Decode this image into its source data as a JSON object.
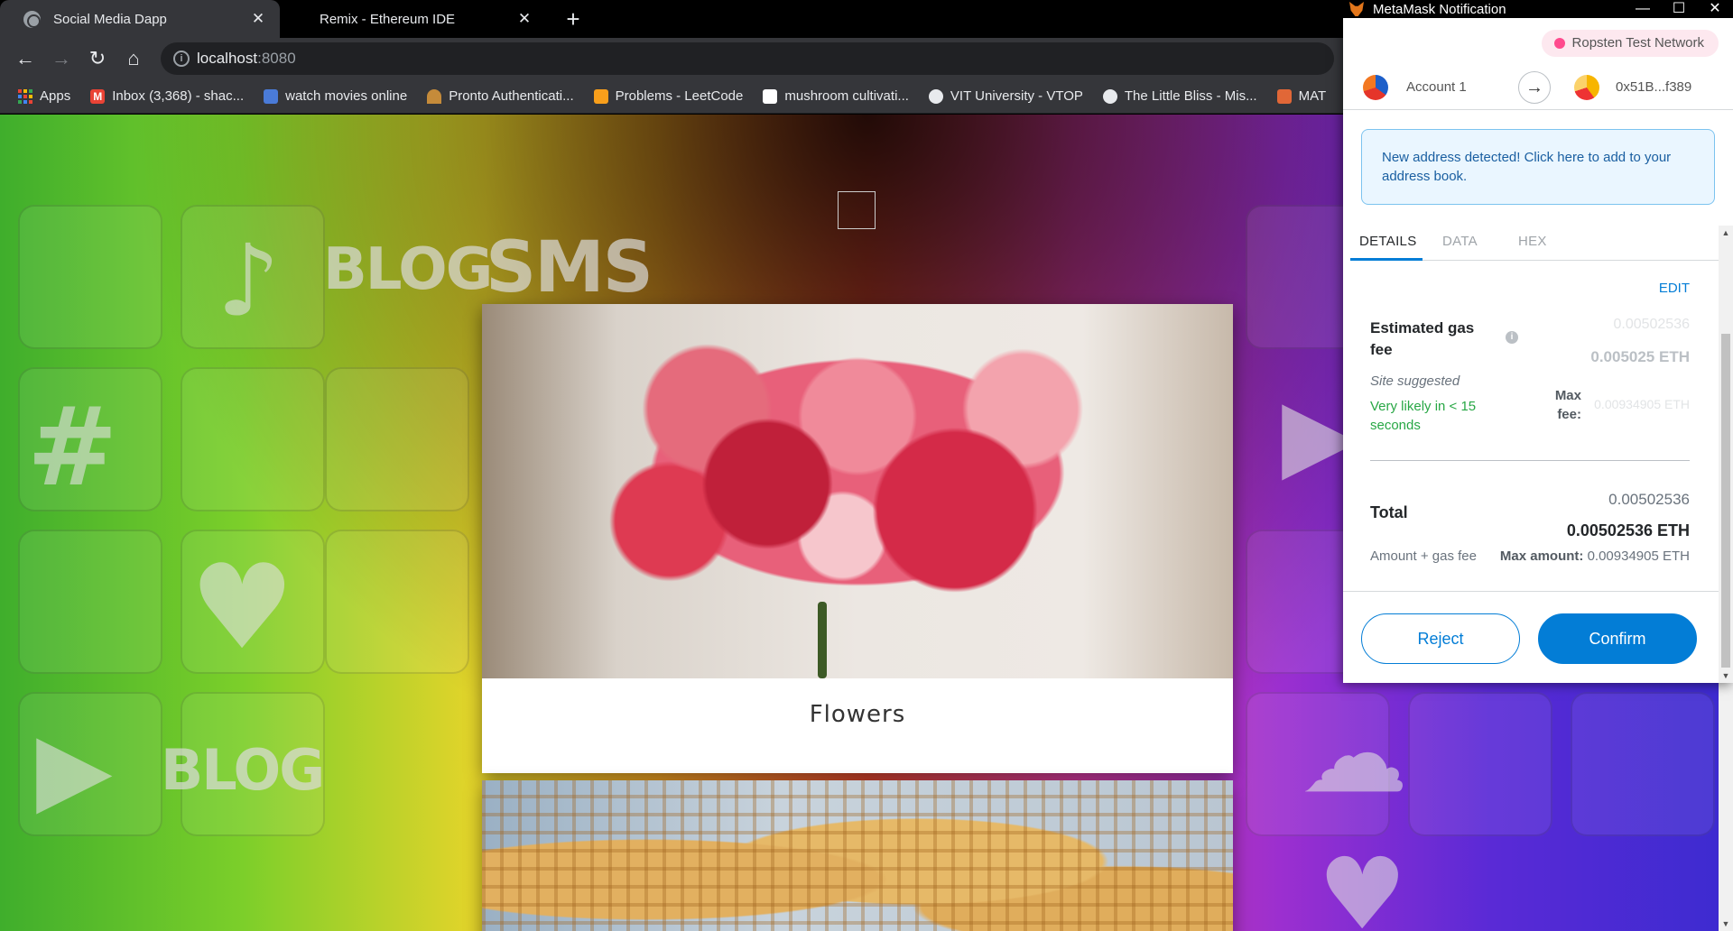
{
  "browser": {
    "tabs": [
      {
        "title": "Social Media Dapp",
        "active": true
      },
      {
        "title": "Remix - Ethereum IDE",
        "active": false
      }
    ],
    "address": {
      "host": "localhost",
      "port": ":8080"
    },
    "bookmarks": [
      {
        "label": "Apps",
        "icon": "apps-grid-icon"
      },
      {
        "label": "Inbox (3,368) - shac...",
        "icon": "gmail-icon",
        "color": "#ea4335"
      },
      {
        "label": "watch movies online",
        "icon": "movie-icon",
        "color": "#4a7bd8"
      },
      {
        "label": "Pronto Authenticati...",
        "icon": "pronto-icon",
        "color": "#c58b3a"
      },
      {
        "label": "Problems - LeetCode",
        "icon": "leetcode-icon",
        "color": "#f89f1b"
      },
      {
        "label": "mushroom cultivati...",
        "icon": "chat-icon",
        "color": "#ffffff"
      },
      {
        "label": "VIT University - VTOP",
        "icon": "globe-icon",
        "color": "#e8eaed"
      },
      {
        "label": "The Little Bliss - Mis...",
        "icon": "globe-icon",
        "color": "#e8eaed"
      },
      {
        "label": "MAT",
        "icon": "matlab-icon",
        "color": "#e16737"
      }
    ]
  },
  "page": {
    "background_words": [
      "BLOG",
      "SMS",
      "BLOG"
    ],
    "posts": [
      {
        "caption": "Flowers",
        "image": "flowers-photo"
      },
      {
        "caption": "",
        "image": "waffles-photo"
      }
    ]
  },
  "metamask": {
    "window_title": "MetaMask Notification",
    "network": "Ropsten Test Network",
    "from_account": "Account 1",
    "to_account": "0x51B...f389",
    "alert": "New address detected! Click here to add to your address book.",
    "tabs": [
      "DETAILS",
      "DATA",
      "HEX"
    ],
    "edit_label": "EDIT",
    "gas": {
      "label": "Estimated gas fee",
      "fiat": "0.00502536",
      "eth": "0.005025 ETH",
      "site_suggested": "Site suggested",
      "likely": "Very likely in < 15 seconds",
      "max_fee_label": "Max fee:",
      "max_fee_value": "0.00934905 ETH"
    },
    "total": {
      "label": "Total",
      "fiat": "0.00502536",
      "eth": "0.00502536 ETH",
      "sub_label": "Amount + gas fee",
      "max_amount_label": "Max amount:",
      "max_amount_value": "0.00934905 ETH"
    },
    "buttons": {
      "reject": "Reject",
      "confirm": "Confirm"
    },
    "colors": {
      "primary": "#037dd6",
      "success": "#28a745",
      "network_dot": "#ff4a8d"
    }
  }
}
